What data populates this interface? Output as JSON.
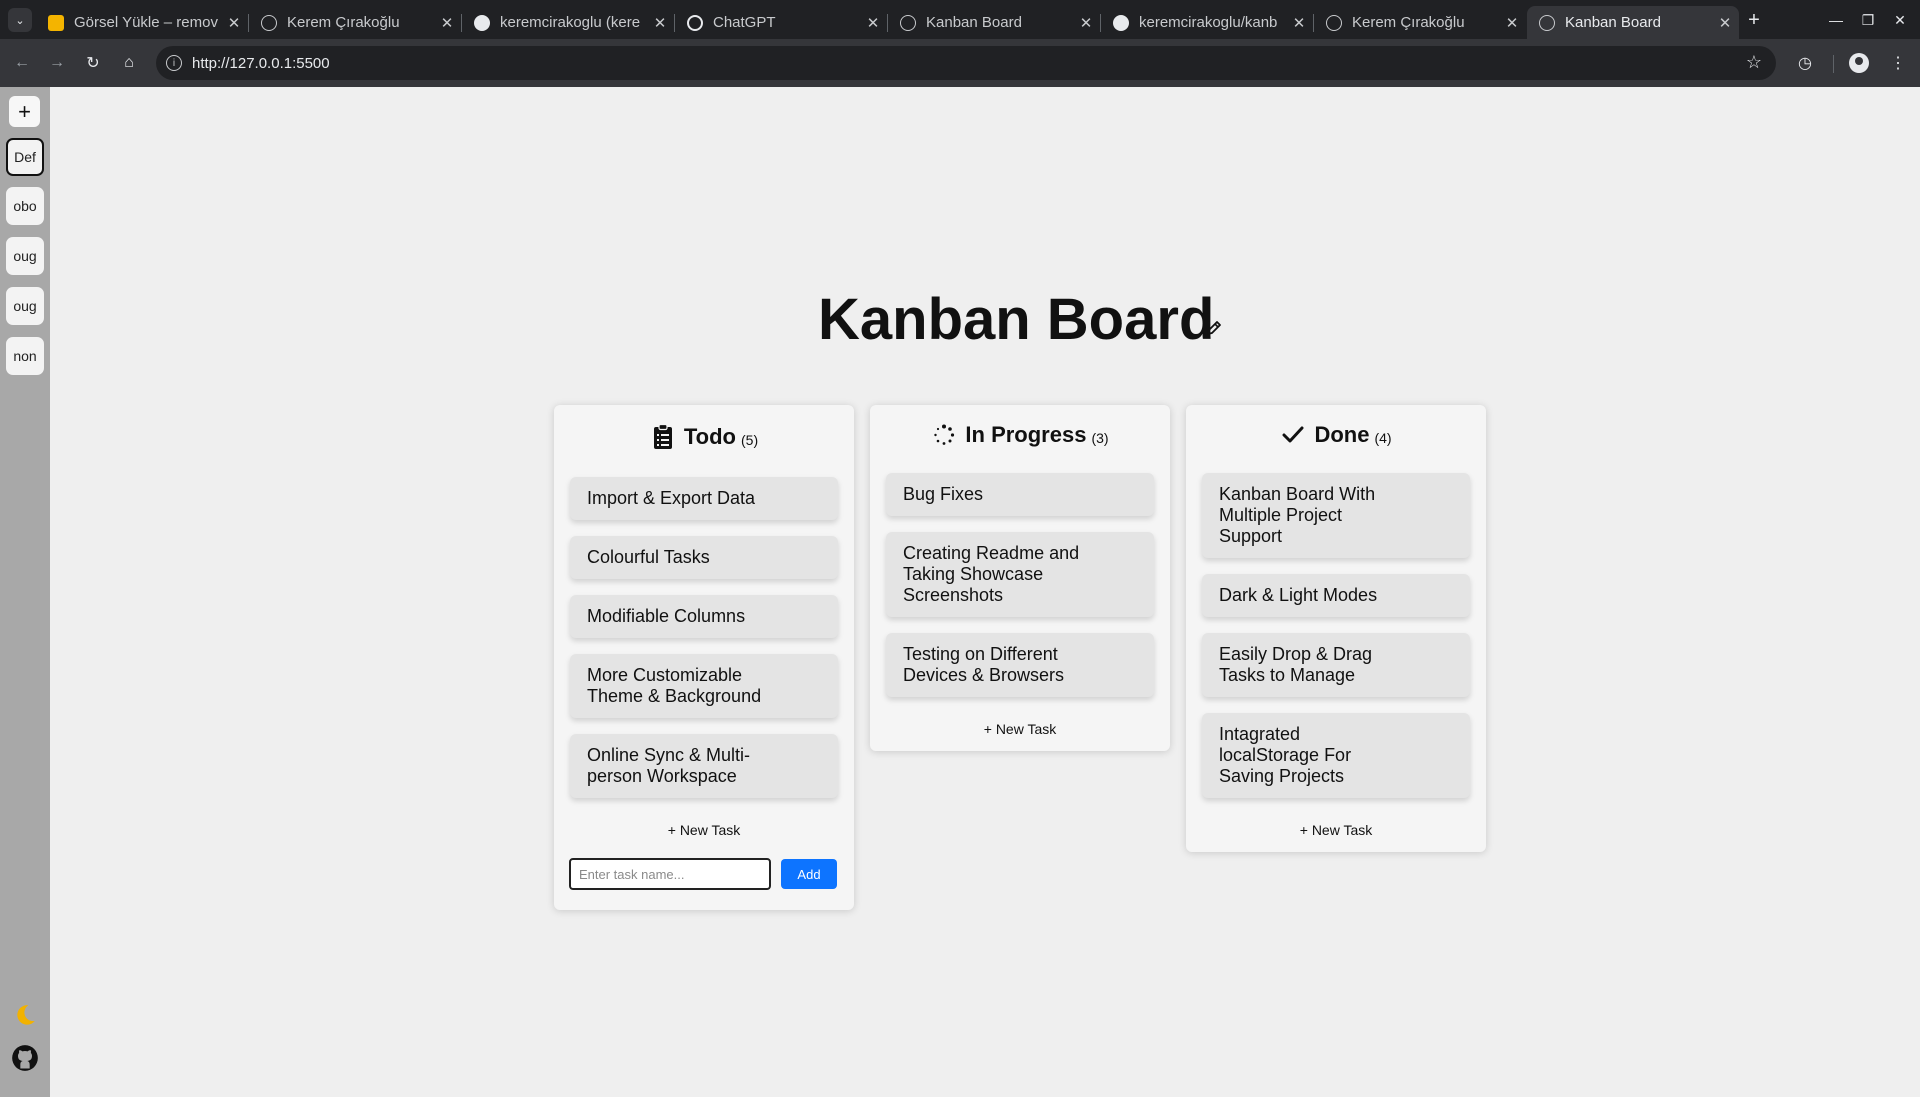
{
  "browser": {
    "tabs": [
      {
        "title": "Görsel Yükle – remov",
        "icon": "remove-bg-icon"
      },
      {
        "title": "Kerem Çırakoğlu",
        "icon": "globe-icon"
      },
      {
        "title": "keremcirakoglu (kere",
        "icon": "github-icon"
      },
      {
        "title": "ChatGPT",
        "icon": "chatgpt-icon"
      },
      {
        "title": "Kanban Board",
        "icon": "globe-icon"
      },
      {
        "title": "keremcirakoglu/kanb",
        "icon": "github-icon"
      },
      {
        "title": "Kerem Çırakoğlu",
        "icon": "globe-icon"
      },
      {
        "title": "Kanban Board",
        "icon": "globe-icon",
        "active": true
      }
    ],
    "url": "http://127.0.0.1:5500"
  },
  "sidebar": {
    "add_label": "+",
    "projects": [
      "Def",
      "obo",
      "oug",
      "oug",
      "non"
    ],
    "active_project": "Def",
    "theme_icon": "moon-icon",
    "repo_icon": "github-icon"
  },
  "board": {
    "title": "Kanban Board",
    "columns": [
      {
        "name": "Todo",
        "count": "(5)",
        "icon": "clipboard-icon",
        "tasks": [
          "Import & Export Data",
          "Colourful Tasks",
          "Modifiable Columns",
          "More Customizable Theme & Background",
          "Online Sync & Multi-person Workspace"
        ],
        "new_task_label": "+ New Task"
      },
      {
        "name": "In Progress",
        "count": "(3)",
        "icon": "spinner-icon",
        "tasks": [
          "Bug Fixes",
          "Creating Readme and Taking Showcase Screenshots",
          "Testing on Different Devices & Browsers"
        ],
        "new_task_label": "+ New Task"
      },
      {
        "name": "Done",
        "count": "(4)",
        "icon": "check-icon",
        "tasks": [
          "Kanban Board With Multiple Project Support",
          "Dark & Light Modes",
          "Easily Drop & Drag Tasks to Manage",
          "Intagrated localStorage For Saving Projects"
        ],
        "new_task_label": "+ New Task"
      }
    ],
    "add_form": {
      "placeholder": "Enter task name...",
      "button_label": "Add"
    }
  },
  "colors": {
    "accent": "#0d74ff",
    "sidebar": "#a8a8a8",
    "background": "#efefef"
  }
}
